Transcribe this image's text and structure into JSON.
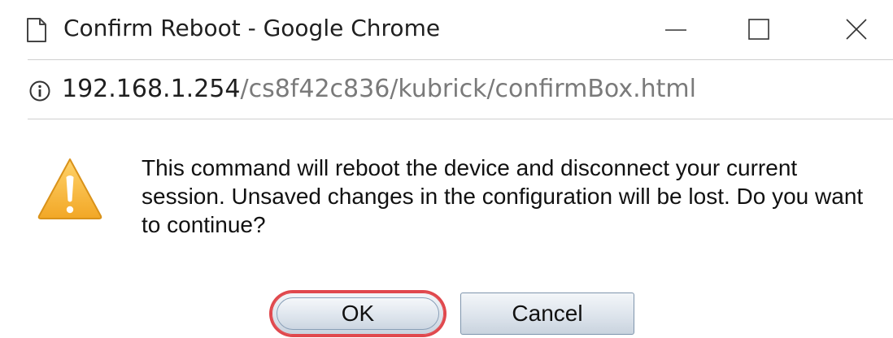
{
  "window": {
    "title": "Confirm Reboot - Google Chrome"
  },
  "address_bar": {
    "host": "192.168.1.254",
    "path": "/cs8f42c836/kubrick/confirmBox.html"
  },
  "dialog": {
    "message": "This command will reboot the device and disconnect your current session. Unsaved changes in the configuration will be lost. Do you want to continue?",
    "ok_label": "OK",
    "cancel_label": "Cancel"
  },
  "colors": {
    "warning_fill": "#f6b73c",
    "highlight_ring": "#e0484d",
    "url_path": "#7a7a7a"
  },
  "icons": {
    "title": "document-icon",
    "address": "info-icon",
    "dialog": "warning-icon"
  }
}
